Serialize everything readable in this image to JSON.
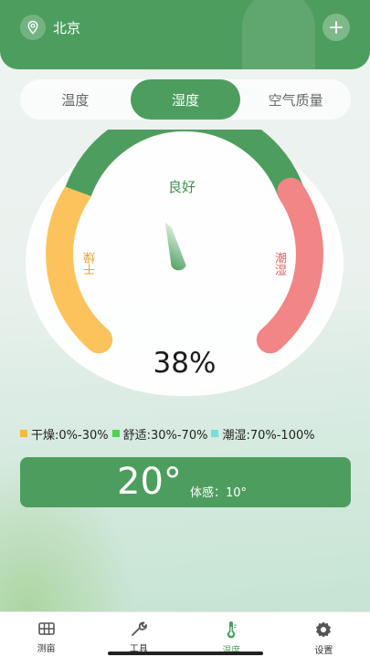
{
  "header": {
    "city": "北京",
    "location_icon": "location-pin-icon",
    "add_icon": "plus-icon"
  },
  "tabs": [
    {
      "label": "温度",
      "active": false
    },
    {
      "label": "湿度",
      "active": true
    },
    {
      "label": "空气质量",
      "active": false
    }
  ],
  "gauge": {
    "value_text": "38%",
    "humidity_percent": 38,
    "zone_good": "良好",
    "zone_dry": "干燥",
    "zone_wet": "潮湿"
  },
  "legend": [
    {
      "label": "干燥:0%-30%",
      "color": "#f6b83d"
    },
    {
      "label": "舒适:30%-70%",
      "color": "#4fd34b"
    },
    {
      "label": "潮湿:70%-100%",
      "color": "#6fe3d8"
    }
  ],
  "temperature": {
    "value": "20°",
    "feels_like": "体感：10°"
  },
  "nav": [
    {
      "label": "测亩",
      "icon": "field-grid-icon",
      "active": false
    },
    {
      "label": "工具",
      "icon": "wrench-icon",
      "active": false
    },
    {
      "label": "温度",
      "icon": "thermometer-icon",
      "active": true
    },
    {
      "label": "设置",
      "icon": "gear-icon",
      "active": false
    }
  ],
  "colors": {
    "primary": "#4d9e5e",
    "dry_arc": "#fcc35d",
    "good_arc": "#4d9e5e",
    "wet_arc": "#f28585"
  }
}
